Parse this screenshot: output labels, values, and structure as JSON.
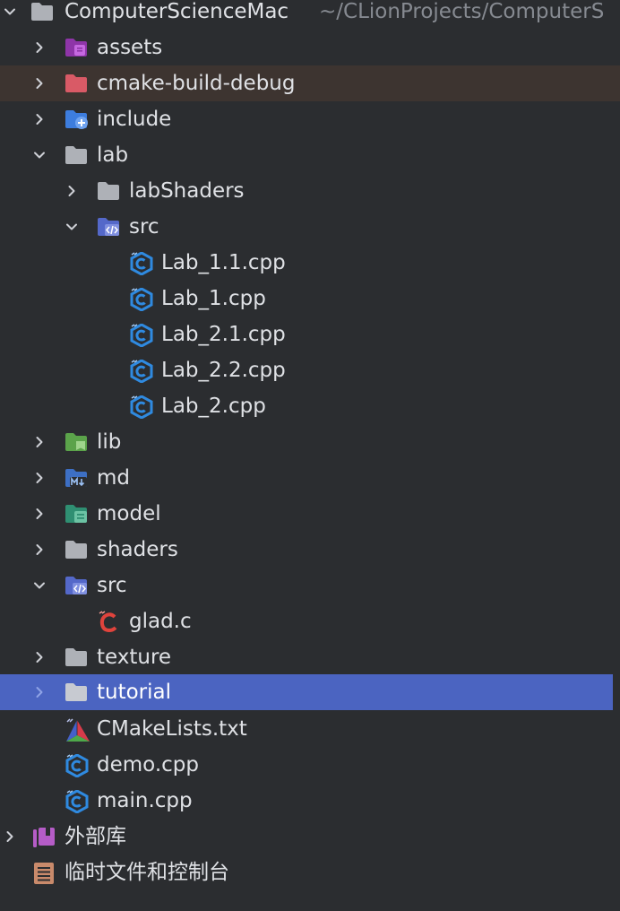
{
  "project": {
    "name": "ComputerScienceMac",
    "path": "~/CLionProjects/ComputerS"
  },
  "items": [
    {
      "label": "assets",
      "icon": "assets-folder-icon"
    },
    {
      "label": "cmake-build-debug",
      "icon": "excluded-folder-icon"
    },
    {
      "label": "include",
      "icon": "include-folder-icon"
    },
    {
      "label": "lab",
      "icon": "folder-icon"
    },
    {
      "label": "labShaders",
      "icon": "folder-icon"
    },
    {
      "label": "src",
      "icon": "source-folder-icon"
    },
    {
      "label": "Lab_1.1.cpp",
      "icon": "cpp-file-icon"
    },
    {
      "label": "Lab_1.cpp",
      "icon": "cpp-file-icon"
    },
    {
      "label": "Lab_2.1.cpp",
      "icon": "cpp-file-icon"
    },
    {
      "label": "Lab_2.2.cpp",
      "icon": "cpp-file-icon"
    },
    {
      "label": "Lab_2.cpp",
      "icon": "cpp-file-icon"
    },
    {
      "label": "lib",
      "icon": "library-folder-icon"
    },
    {
      "label": "md",
      "icon": "markdown-folder-icon"
    },
    {
      "label": "model",
      "icon": "resource-folder-icon"
    },
    {
      "label": "shaders",
      "icon": "folder-icon"
    },
    {
      "label": "src",
      "icon": "source-folder-icon"
    },
    {
      "label": "glad.c",
      "icon": "c-file-icon"
    },
    {
      "label": "texture",
      "icon": "folder-icon"
    },
    {
      "label": "tutorial",
      "icon": "folder-icon"
    },
    {
      "label": "CMakeLists.txt",
      "icon": "cmake-icon"
    },
    {
      "label": "demo.cpp",
      "icon": "cpp-file-icon"
    },
    {
      "label": "main.cpp",
      "icon": "cpp-file-icon"
    },
    {
      "label": "外部库",
      "icon": "external-libraries-icon"
    },
    {
      "label": "临时文件和控制台",
      "icon": "scratches-icon"
    }
  ],
  "colors": {
    "background": "#2b2d30",
    "selected": "#4b64c1",
    "excluded_row": "#3d3430",
    "text": "#dfe1e5",
    "muted_text": "#868a91"
  }
}
